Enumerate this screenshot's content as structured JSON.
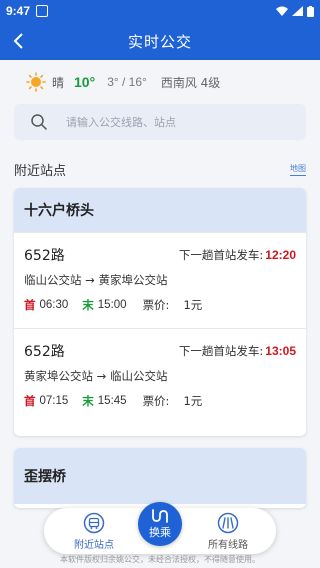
{
  "status_bar": {
    "time": "9:47"
  },
  "header": {
    "title": "实时公交"
  },
  "weather": {
    "condition": "晴",
    "temperature": "10°",
    "range": "3° / 16°",
    "wind": "西南风 4级"
  },
  "search": {
    "placeholder": "请输入公交线路、站点"
  },
  "nearby": {
    "label": "附近站点",
    "map_link": "地图"
  },
  "stops": [
    {
      "name": "十六户桥头",
      "routes": [
        {
          "number": "652路",
          "next_label": "下一趟首站发车:",
          "next_time": "12:20",
          "direction": "临山公交站 → 黄家埠公交站",
          "first_tag": "首",
          "first_time": "06:30",
          "last_tag": "末",
          "last_time": "15:00",
          "fare_label": "票价:",
          "fare": "1元"
        },
        {
          "number": "652路",
          "next_label": "下一趟首站发车:",
          "next_time": "13:05",
          "direction": "黄家埠公交站 → 临山公交站",
          "first_tag": "首",
          "first_time": "07:15",
          "last_tag": "末",
          "last_time": "15:45",
          "fare_label": "票价:",
          "fare": "1元"
        }
      ]
    },
    {
      "name": "歪摆桥"
    }
  ],
  "bottom_nav": {
    "nearby": "附近站点",
    "transfer": "换乘",
    "all_routes": "所有线路"
  },
  "footer": "本软件版权归余姚公交，未经合法授权，不得随意使用。",
  "colors": {
    "primary": "#1e62d6",
    "red": "#d0161f",
    "green": "#1a9b3c"
  }
}
